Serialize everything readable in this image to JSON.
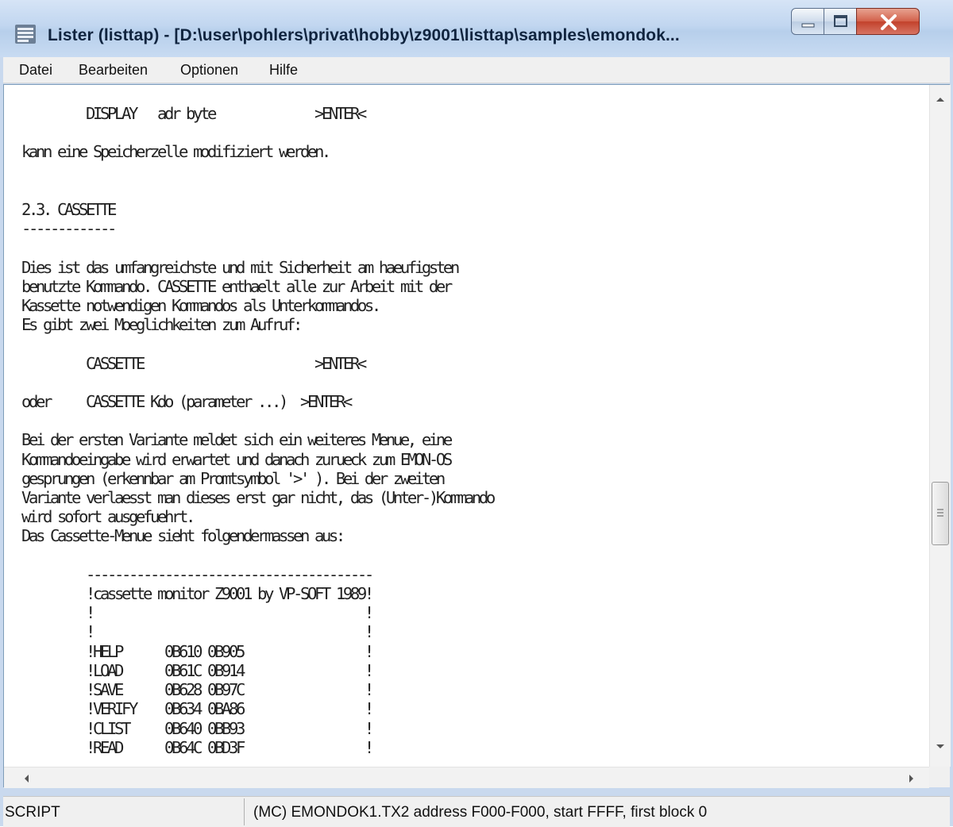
{
  "window": {
    "title": "Lister (listtap) - [D:\\user\\pohlers\\privat\\hobby\\z9001\\listtap\\samples\\emondok...",
    "colors": {
      "title_text": "#10243f",
      "close_button": "#c2412b",
      "background": "#ffffff"
    }
  },
  "menu": {
    "items": [
      "Datei",
      "Bearbeiten",
      "Optionen",
      "Hilfe"
    ]
  },
  "content": {
    "lines": [
      "         DISPLAY   adr byte              >ENTER<",
      "",
      "kann eine Speicherzelle modifiziert werden.",
      "",
      "",
      "2.3. CASSETTE",
      "-------------",
      "",
      "Dies ist das umfangreichste und mit Sicherheit am haeufigsten",
      "benutzte Kommando. CASSETTE enthaelt alle zur Arbeit mit der",
      "Kassette notwendigen Kommandos als Unterkommandos.",
      "Es gibt zwei Moeglichkeiten zum Aufruf:",
      "",
      "         CASSETTE                        >ENTER<",
      "",
      "oder     CASSETTE Kdo (parameter ...)  >ENTER<",
      "",
      "Bei der ersten Variante meldet sich ein weiteres Menue, eine",
      "Kommandoeingabe wird erwartet und danach zurueck zum EMON-OS",
      "gesprungen (erkennbar am Promtsymbol '>' ). Bei der zweiten",
      "Variante verlaesst man dieses erst gar nicht, das (Unter-)Kommando",
      "wird sofort ausgefuehrt.",
      "Das Cassette-Menue sieht folgendermassen aus:",
      "",
      "         ----------------------------------------",
      "         !cassette monitor Z9001 by VP-SOFT 1989!",
      "         !                                      !",
      "         !                                      !",
      "         !HELP      0B610 0B905                 !",
      "         !LOAD      0B61C 0B914                 !",
      "         !SAVE      0B628 0B97C                 !",
      "         !VERIFY    0B634 0BA86                 !",
      "         !CLIST     0B640 0BB93                 !",
      "         !READ      0B64C 0BD3F                 !"
    ]
  },
  "status": {
    "mode": "SCRIPT",
    "info": "(MC) EMONDOK1.TX2 address F000-F000, start FFFF, first block 0"
  },
  "icons": {
    "app": "lister-icon",
    "minimize": "minimize-icon",
    "maximize": "maximize-icon",
    "close": "close-icon",
    "scroll_up": "arrow-up-icon",
    "scroll_down": "arrow-down-icon",
    "scroll_left": "arrow-left-icon",
    "scroll_right": "arrow-right-icon",
    "grip": "grip-icon"
  }
}
